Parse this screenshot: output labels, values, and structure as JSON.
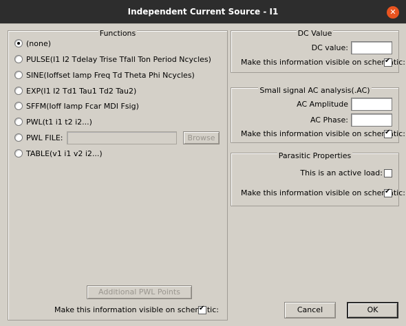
{
  "window": {
    "title": "Independent Current Source - I1",
    "close_glyph": "✕"
  },
  "functions": {
    "title": "Functions",
    "options": [
      {
        "label": "(none)",
        "checked": true
      },
      {
        "label": "PULSE(I1 I2 Tdelay Trise Tfall Ton Period Ncycles)",
        "checked": false
      },
      {
        "label": "SINE(Ioffset Iamp Freq Td Theta Phi Ncycles)",
        "checked": false
      },
      {
        "label": "EXP(I1 I2 Td1 Tau1 Td2 Tau2)",
        "checked": false
      },
      {
        "label": "SFFM(Ioff Iamp Fcar MDI Fsig)",
        "checked": false
      },
      {
        "label": "PWL(t1 i1 t2 i2...)",
        "checked": false
      },
      {
        "label": "PWL FILE:",
        "checked": false
      },
      {
        "label": "TABLE(v1 i1 v2 i2...)",
        "checked": false
      }
    ],
    "pwl_file_value": "",
    "browse_label": "Browse",
    "additional_pwl_label": "Additional PWL Points",
    "visible_label": "Make this information visible on schematic:",
    "visible_checked": true
  },
  "dc": {
    "title": "DC Value",
    "value_label": "DC value:",
    "value": "",
    "visible_label": "Make this information visible on schematic:",
    "visible_checked": true
  },
  "ac": {
    "title": "Small signal AC analysis(.AC)",
    "amplitude_label": "AC Amplitude",
    "amplitude_value": "",
    "phase_label": "AC Phase:",
    "phase_value": "",
    "visible_label": "Make this information visible on schematic:",
    "visible_checked": true
  },
  "parasitic": {
    "title": "Parasitic Properties",
    "active_load_label": "This is an active load:",
    "active_load_checked": false,
    "visible_label": "Make this information visible on schematic:",
    "visible_checked": true
  },
  "buttons": {
    "cancel": "Cancel",
    "ok": "OK"
  }
}
